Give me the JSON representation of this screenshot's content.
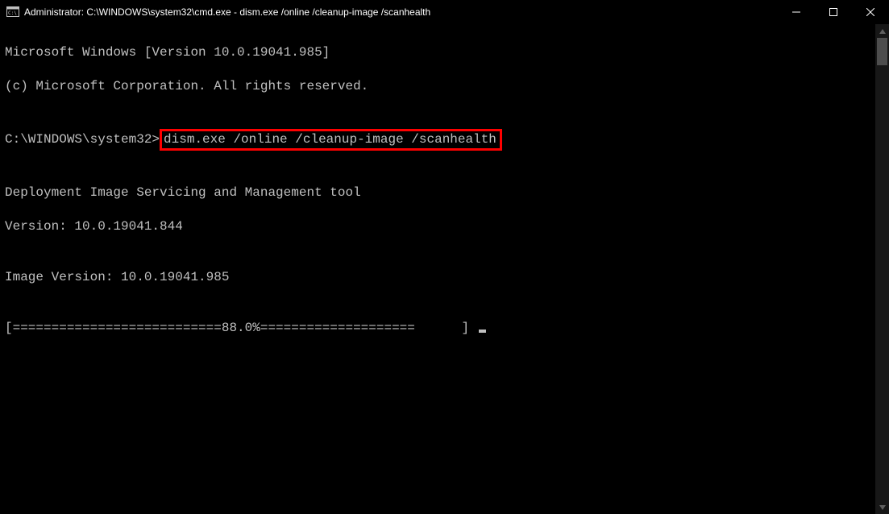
{
  "titlebar": {
    "title": "Administrator: C:\\WINDOWS\\system32\\cmd.exe - dism.exe  /online /cleanup-image /scanhealth"
  },
  "terminal": {
    "line1": "Microsoft Windows [Version 10.0.19041.985]",
    "line2": "(c) Microsoft Corporation. All rights reserved.",
    "blank1": "",
    "prompt_prefix": "C:\\WINDOWS\\system32>",
    "command": "dism.exe /online /cleanup-image /scanhealth",
    "blank2": "",
    "tool1": "Deployment Image Servicing and Management tool",
    "tool2": "Version: 10.0.19041.844",
    "blank3": "",
    "imgver": "Image Version: 10.0.19041.985",
    "blank4": "",
    "progress": "[===========================88.0%====================      ] "
  }
}
